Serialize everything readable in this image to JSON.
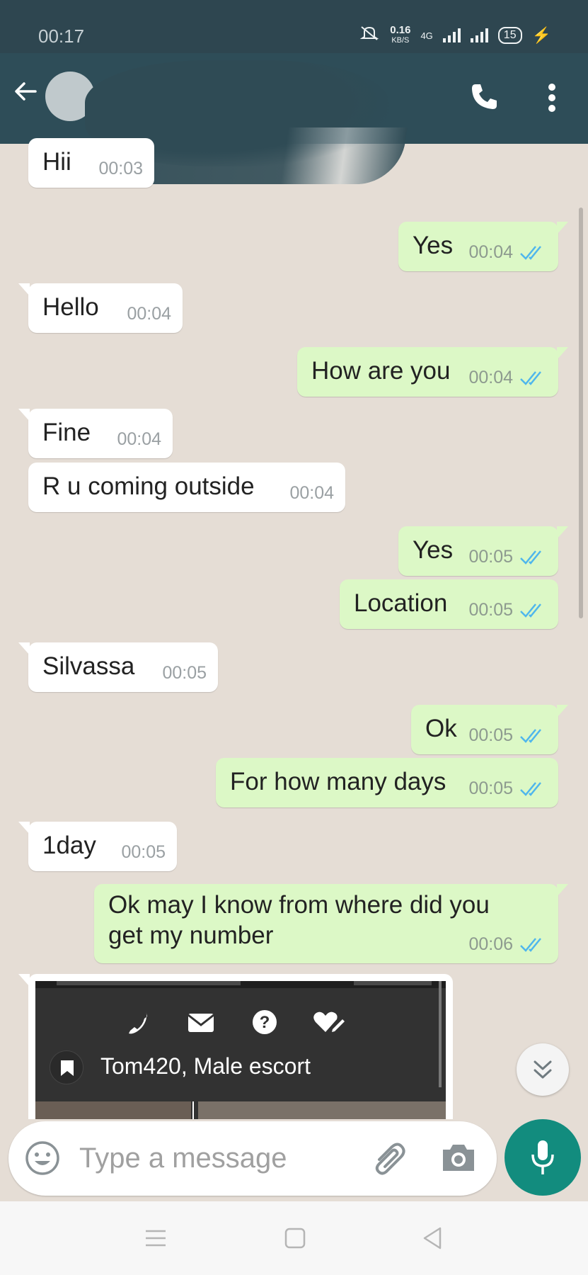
{
  "status_bar": {
    "time": "00:17",
    "net_speed": "0.16",
    "net_unit": "KB/S",
    "network_type": "4G",
    "battery": "15"
  },
  "messages": [
    {
      "dir": "in",
      "text": "Hii",
      "time": "00:03"
    },
    {
      "dir": "out",
      "text": "Yes",
      "time": "00:04"
    },
    {
      "dir": "in",
      "text": "Hello",
      "time": "00:04"
    },
    {
      "dir": "out",
      "text": "How are you",
      "time": "00:04"
    },
    {
      "dir": "in",
      "text": "Fine",
      "time": "00:04"
    },
    {
      "dir": "in",
      "text": "R u coming outside",
      "time": "00:04"
    },
    {
      "dir": "out",
      "text": "Yes",
      "time": "00:05"
    },
    {
      "dir": "out",
      "text": "Location",
      "time": "00:05"
    },
    {
      "dir": "in",
      "text": "Silvassa",
      "time": "00:05"
    },
    {
      "dir": "out",
      "text": "Ok",
      "time": "00:05"
    },
    {
      "dir": "out",
      "text": "For how many days",
      "time": "00:05"
    },
    {
      "dir": "in",
      "text": "1day",
      "time": "00:05"
    },
    {
      "dir": "out",
      "text": "Ok may I know from where did you get my number",
      "time": "00:06"
    }
  ],
  "preview": {
    "profile_name": "Tom420, Male escort"
  },
  "composer": {
    "placeholder": "Type a message"
  },
  "colors": {
    "header": "#2e4d58",
    "outgoing_bubble": "#dcf8c6",
    "incoming_bubble": "#ffffff",
    "chat_background": "#e5ddd5",
    "read_tick": "#4fb6ec",
    "mic_button": "#128c7e"
  },
  "icons": {
    "header": [
      "back-arrow-icon",
      "phone-icon",
      "more-vert-icon"
    ],
    "composer": [
      "emoji-icon",
      "attach-icon",
      "camera-icon",
      "mic-icon"
    ],
    "preview": [
      "phone-icon",
      "mail-icon",
      "help-icon",
      "favorite-edit-icon",
      "bookmark-icon"
    ],
    "nav": [
      "menu-icon",
      "home-icon",
      "back-icon"
    ]
  }
}
